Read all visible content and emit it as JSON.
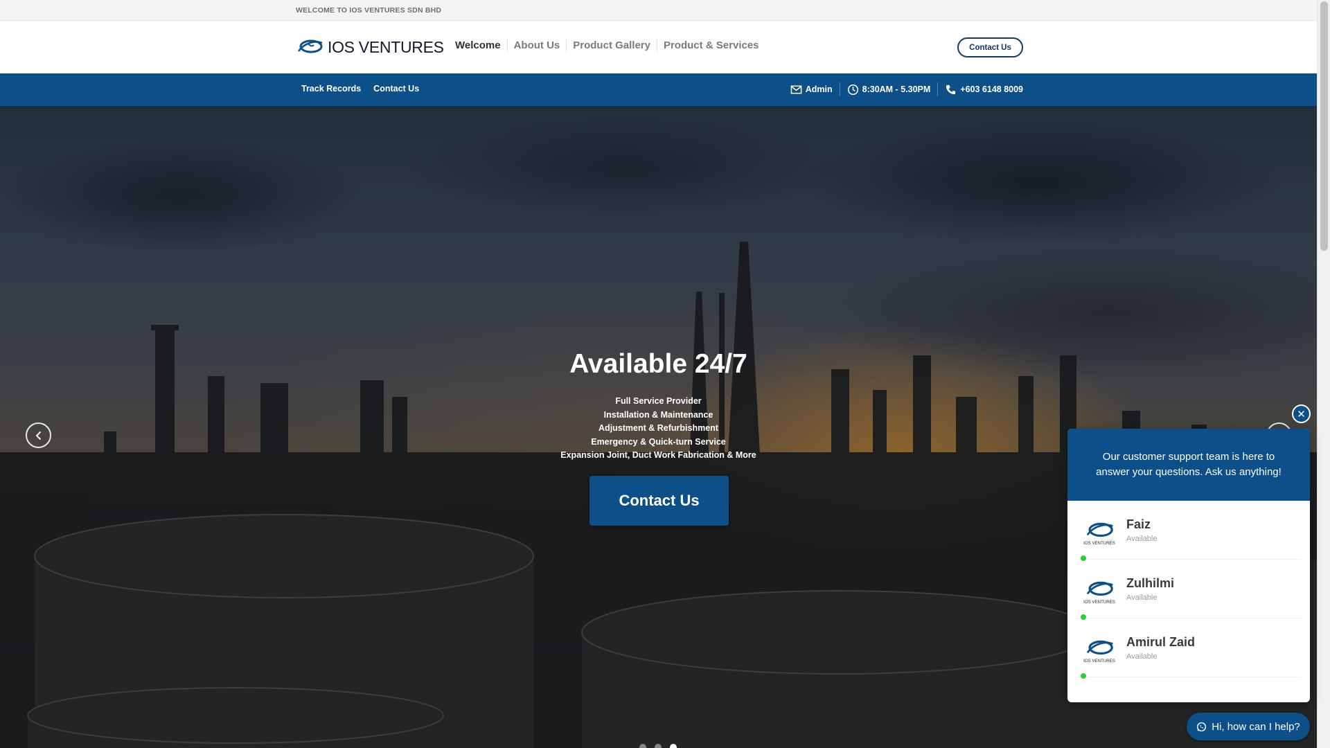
{
  "topbar": {
    "welcome": "WELCOME TO IOS VENTURES SDN BHD"
  },
  "header": {
    "logo_text": "IOS VENTURES",
    "nav": [
      {
        "label": "Welcome",
        "active": true
      },
      {
        "label": "About Us"
      },
      {
        "label": "Product Gallery"
      },
      {
        "label": "Product & Services"
      }
    ],
    "contact_button": "Contact Us"
  },
  "subbar": {
    "links": [
      "Track Records",
      "Contact Us"
    ],
    "email": {
      "icon": "envelope-icon",
      "label": "Admin"
    },
    "hours": {
      "icon": "clock-icon",
      "label": "8:30AM - 5.30PM"
    },
    "phone": {
      "icon": "phone-icon",
      "label": "+603 6148 8009"
    }
  },
  "hero": {
    "title": "Available 24/7",
    "lines": [
      "Full Service Provider",
      "Installation & Maintenance",
      "Adjustment & Refurbishment",
      "Emergency & Quick-turn Service",
      "Expansion Joint, Duct Work Fabrication & More"
    ],
    "cta": "Contact Us",
    "slides": {
      "count": 3,
      "active": 3
    }
  },
  "chat": {
    "intro": "Our customer support team is here to answer your questions. Ask us anything!",
    "avatar_caption": "IOS VENTURES",
    "agents": [
      {
        "name": "Faiz",
        "status": "Available"
      },
      {
        "name": "Zulhilmi",
        "status": "Available"
      },
      {
        "name": "Amirul Zaid",
        "status": "Available"
      }
    ],
    "button_label": "Hi, how can I help?"
  },
  "colors": {
    "brand_blue": "#0d4f88",
    "online_green": "#2ecc40"
  }
}
